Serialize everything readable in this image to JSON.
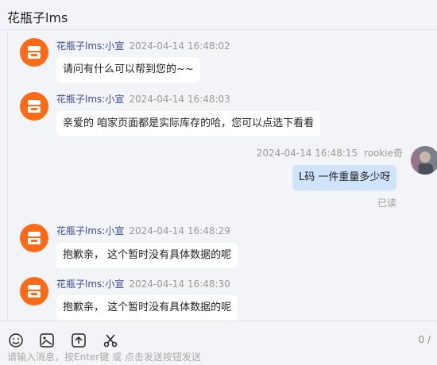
{
  "header": {
    "title": "花瓶子lms"
  },
  "messages": [
    {
      "sender": "花瓶子lms:小宣",
      "time": "2024-04-14 16:48:02",
      "text": "请问有什么可以帮到您的~~"
    },
    {
      "sender": "花瓶子lms:小宣",
      "time": "2024-04-14 16:48:03",
      "text": "亲爱的  咱家页面都是实际库存的哈，您可以点选下看看"
    },
    {
      "sender": "rookie奇",
      "time": "2024-04-14 16:48:15",
      "text": "L码 一件重量多少呀",
      "status": "已读"
    },
    {
      "sender": "花瓶子lms:小宣",
      "time": "2024-04-14 16:48:29",
      "text": "抱歉亲， 这个暂时没有具体数据的呢"
    },
    {
      "sender": "花瓶子lms:小宣",
      "time": "2024-04-14 16:48:30",
      "text": "抱歉亲， 这个暂时没有具体数据的呢"
    }
  ],
  "toolbar": {
    "icons": [
      "emoji-icon",
      "image-icon",
      "upload-icon",
      "scissors-icon"
    ],
    "counter": "0 /",
    "placeholder": "请输入消息，按Enter键 或 点击发送按钮发送"
  },
  "colors": {
    "shop_avatar": "#ff6a17",
    "my_bubble": "#cfe3fb",
    "sender_name": "#3a4b9a"
  }
}
